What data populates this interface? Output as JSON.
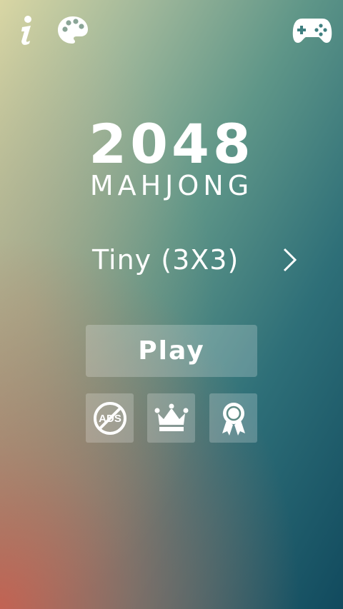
{
  "topbar": {
    "info_icon": "info-icon",
    "palette_icon": "palette-icon",
    "gamepad_icon": "gamepad-icon"
  },
  "title": {
    "number": "2048",
    "subtitle": "MAHJONG"
  },
  "mode": {
    "label": "Tiny (3X3)",
    "next_icon": "chevron-right-icon"
  },
  "play": {
    "label": "Play"
  },
  "actions": {
    "remove_ads_icon": "no-ads-icon",
    "remove_ads_text": "ADS",
    "leaderboard_icon": "crown-icon",
    "achievements_icon": "award-ribbon-icon"
  },
  "colors": {
    "gradient_top_left": "#d9d6a4",
    "gradient_bottom_right": "#114a5e",
    "gradient_bottom_left": "#c86050",
    "text": "#ffffff",
    "button_fill": "rgba(255,255,255,0.22)"
  }
}
